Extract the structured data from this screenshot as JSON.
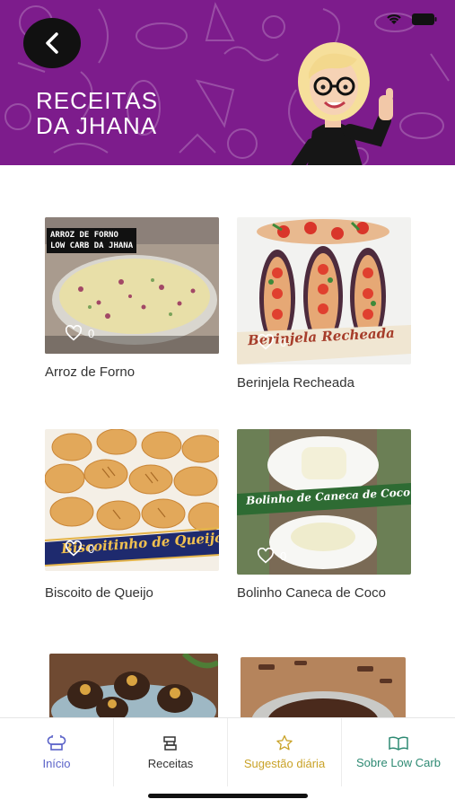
{
  "header": {
    "title_line1": "RECEITAS",
    "title_line2": "DA JHANA",
    "background_color": "#7d1c8c",
    "back_icon": "chevron-left-icon",
    "status_icons": [
      "wifi-icon",
      "battery-icon"
    ]
  },
  "recipes": [
    {
      "name": "Arroz de Forno",
      "likes": "0",
      "overlay_line1": "ARROZ DE FORNO",
      "overlay_line2": "LOW CARB DA JHANA"
    },
    {
      "name": "Berinjela Recheada",
      "likes": "0",
      "banner": "Berinjela Recheada"
    },
    {
      "name": "Biscoito de Queijo",
      "likes": "0",
      "banner": "Biscoitinho de Queijo"
    },
    {
      "name": "Bolinho Caneca de Coco",
      "likes": "0",
      "banner": "Bolinho de Caneca de Coco"
    },
    {
      "name": "",
      "likes": ""
    },
    {
      "name": "",
      "likes": ""
    }
  ],
  "tabs": [
    {
      "label": "Início",
      "icon": "chef-hat-icon",
      "color": "#5a62c8"
    },
    {
      "label": "Receitas",
      "icon": "recipe-book-icon",
      "color": "#333333"
    },
    {
      "label": "Sugestão diária",
      "icon": "star-icon",
      "color": "#c9a227"
    },
    {
      "label": "Sobre Low Carb",
      "icon": "open-book-icon",
      "color": "#2e8a73"
    }
  ]
}
